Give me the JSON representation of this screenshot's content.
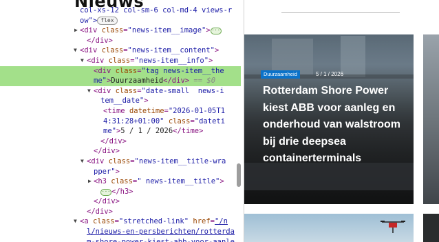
{
  "devtools": {
    "page_heading_fragment": "Nieuws",
    "lines": [
      {
        "segs": [
          [
            "val",
            "col-xs-12 col-sm-6 col-md-4 views-r"
          ]
        ]
      },
      {
        "segs": [
          [
            "val",
            "ow\">"
          ],
          [
            "badge",
            "flex"
          ]
        ]
      },
      {
        "tri": "right",
        "segs": [
          [
            "tag",
            "<div "
          ],
          [
            "attr",
            "class"
          ],
          [
            "tag",
            "="
          ],
          [
            "val",
            "\"news-item__image\""
          ],
          [
            "tag",
            ">"
          ],
          [
            "dots",
            "···"
          ]
        ]
      },
      {
        "segs": [
          [
            "tag",
            "</div>"
          ]
        ]
      },
      {
        "tri": "down",
        "segs": [
          [
            "tag",
            "<div "
          ],
          [
            "attr",
            "class"
          ],
          [
            "tag",
            "="
          ],
          [
            "val",
            "\"news-item__content\""
          ],
          [
            "tag",
            ">"
          ]
        ]
      },
      {
        "tri": "down",
        "segs": [
          [
            "tag",
            "<div "
          ],
          [
            "attr",
            "class"
          ],
          [
            "tag",
            "="
          ],
          [
            "val",
            "\"news-item__info\""
          ],
          [
            "tag",
            ">"
          ]
        ]
      },
      {
        "hl": true,
        "segs": [
          [
            "tag",
            "<div "
          ],
          [
            "attr",
            "class"
          ],
          [
            "tag",
            "="
          ],
          [
            "val",
            "\"tag news-item__the"
          ]
        ]
      },
      {
        "hl": true,
        "segs": [
          [
            "val",
            "me\""
          ],
          [
            "tag",
            ">"
          ],
          [
            "txt",
            "Duurzaamheid"
          ],
          [
            "tag",
            "</div>"
          ],
          [
            "eq",
            " == $0"
          ]
        ]
      },
      {
        "tri": "down",
        "segs": [
          [
            "tag",
            "<div "
          ],
          [
            "attr",
            "class"
          ],
          [
            "tag",
            "="
          ],
          [
            "val",
            "\"date-small  news-i"
          ]
        ]
      },
      {
        "segs": [
          [
            "val",
            "tem__date\""
          ],
          [
            "tag",
            ">"
          ]
        ]
      },
      {
        "segs": [
          [
            "tag",
            "<time "
          ],
          [
            "attr",
            "datetime"
          ],
          [
            "tag",
            "="
          ],
          [
            "val",
            "\"2026-01-05T1"
          ]
        ]
      },
      {
        "segs": [
          [
            "val",
            "4:31:28+01:00\""
          ],
          [
            "attr",
            " class"
          ],
          [
            "tag",
            "="
          ],
          [
            "val",
            "\"dateti"
          ]
        ]
      },
      {
        "segs": [
          [
            "val",
            "me\""
          ],
          [
            "tag",
            ">"
          ],
          [
            "txt",
            "5 / 1 / 2026"
          ],
          [
            "tag",
            "</time>"
          ]
        ]
      },
      {
        "segs": [
          [
            "tag",
            "</div>"
          ]
        ]
      },
      {
        "segs": [
          [
            "tag",
            "</div>"
          ]
        ]
      },
      {
        "tri": "down",
        "segs": [
          [
            "tag",
            "<div "
          ],
          [
            "attr",
            "class"
          ],
          [
            "tag",
            "="
          ],
          [
            "val",
            "\"news-item__title-wra"
          ]
        ]
      },
      {
        "segs": [
          [
            "val",
            "pper\""
          ],
          [
            "tag",
            ">"
          ]
        ]
      },
      {
        "tri": "right",
        "segs": [
          [
            "tag",
            "<h3 "
          ],
          [
            "attr",
            "class"
          ],
          [
            "tag",
            "="
          ],
          [
            "val",
            "\" news-item__title\""
          ],
          [
            "tag",
            ">"
          ]
        ]
      },
      {
        "segs": [
          [
            "dots",
            "···"
          ],
          [
            "tag",
            "</h3>"
          ]
        ]
      },
      {
        "segs": [
          [
            "tag",
            "</div>"
          ]
        ]
      },
      {
        "segs": [
          [
            "tag",
            "</div>"
          ]
        ]
      },
      {
        "tri": "down",
        "segs": [
          [
            "tag",
            "<a "
          ],
          [
            "attr",
            "class"
          ],
          [
            "tag",
            "="
          ],
          [
            "val",
            "\"stretched-link\""
          ],
          [
            "attr",
            " href"
          ],
          [
            "tag",
            "="
          ],
          [
            "link",
            "\"/n"
          ]
        ]
      },
      {
        "segs": [
          [
            "link",
            "l/nieuws-en-persberichten/rotterda"
          ]
        ]
      },
      {
        "segs": [
          [
            "link",
            "m-shore-power-kiest-abb-voor-aanle"
          ]
        ]
      }
    ]
  },
  "site": {
    "tag_label": "Duurzaamheid",
    "date": "5 / 1 / 2026",
    "title": "Rotterdam Shore Power kiest ABB voor aanleg en onderhoud van walstroom bij drie deepsea containerterminals"
  }
}
